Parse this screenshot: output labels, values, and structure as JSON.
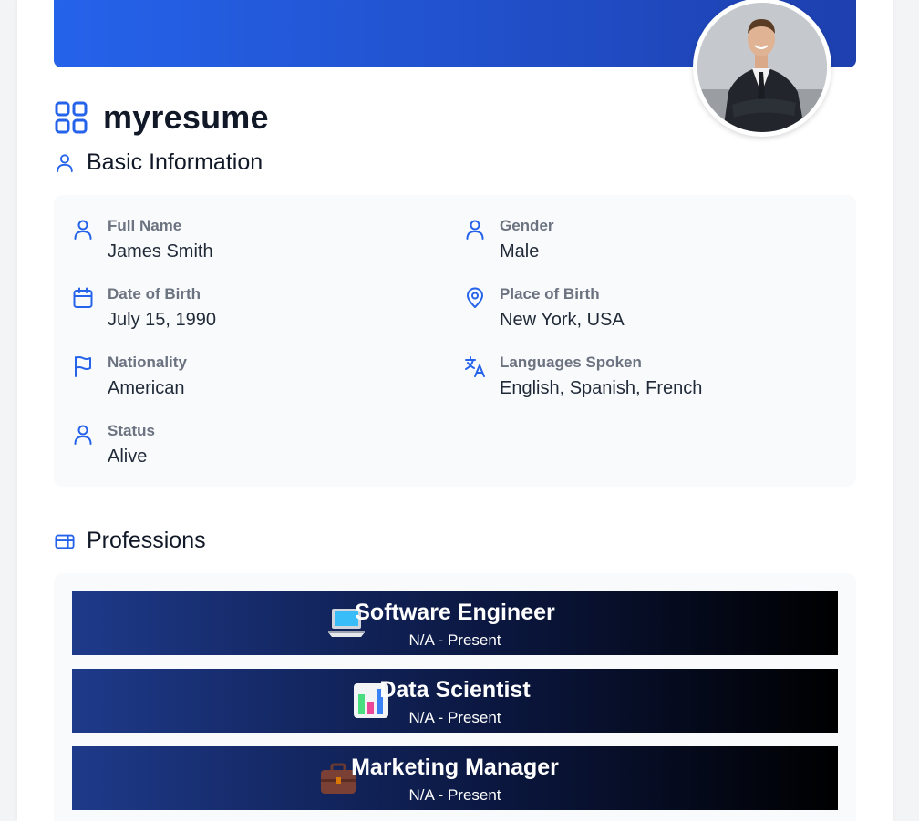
{
  "app": {
    "title": "myresume"
  },
  "sections": {
    "basic_info": "Basic Information",
    "professions": "Professions"
  },
  "basic_info": {
    "full_name": {
      "label": "Full Name",
      "value": "James Smith",
      "icon": "user-icon"
    },
    "gender": {
      "label": "Gender",
      "value": "Male",
      "icon": "user-icon"
    },
    "dob": {
      "label": "Date of Birth",
      "value": "July 15, 1990",
      "icon": "calendar-icon"
    },
    "pob": {
      "label": "Place of Birth",
      "value": "New York, USA",
      "icon": "map-pin-icon"
    },
    "nationality": {
      "label": "Nationality",
      "value": "American",
      "icon": "flag-icon"
    },
    "languages": {
      "label": "Languages Spoken",
      "value": "English, Spanish, French",
      "icon": "translate-icon"
    },
    "status": {
      "label": "Status",
      "value": "Alive",
      "icon": "user-icon"
    }
  },
  "professions": [
    {
      "title": "Software Engineer",
      "period": "N/A - Present",
      "icon": "laptop-icon"
    },
    {
      "title": "Data Scientist",
      "period": "N/A - Present",
      "icon": "bar-chart-icon"
    },
    {
      "title": "Marketing Manager",
      "period": "N/A - Present",
      "icon": "briefcase-icon"
    }
  ],
  "colors": {
    "accent": "#2563eb",
    "banner_start": "#2563eb",
    "banner_end": "#1e40af",
    "card_bg": "#f9fafb",
    "label": "#6b7280",
    "profession_start": "#1e3a8a",
    "profession_end": "#000000"
  }
}
